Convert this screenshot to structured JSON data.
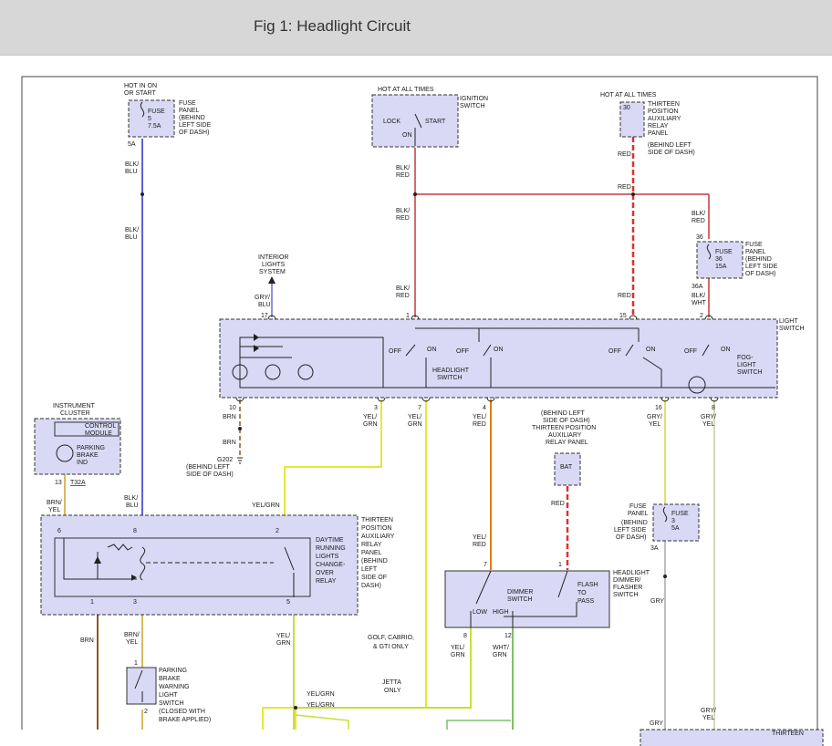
{
  "figure": {
    "title": "Fig 1: Headlight Circuit"
  },
  "colors": {
    "blue": "#2b2bcc",
    "red": "#c23b3b",
    "bright_red": "#e03030",
    "yellow": "#e6e63a",
    "yellow_green": "#c9df35",
    "brown": "#8b5a1e",
    "orange": "#e07d10",
    "green": "#7cbf6a",
    "gray": "#b9b9b9",
    "panel": "#d9d9f5"
  },
  "labels": {
    "hot_in_on": "HOT IN ON",
    "or_start": "OR START",
    "fuse5_a": "FUSE",
    "fuse5_b": "5",
    "fuse5_c": "7.5A",
    "fp1": "FUSE",
    "fp2": "PANEL",
    "fp3": "(BEHIND",
    "fp4": "LEFT SIDE",
    "fp5": "OF DASH)",
    "pin_5a": "5A",
    "blk1": "BLK/",
    "blu1": "BLU",
    "blk2": "BLK/",
    "blu2": "BLU",
    "hot_all_1": "HOT AT ALL TIMES",
    "lock": "LOCK",
    "start": "START",
    "on": "ON",
    "ign1": "IGNITION",
    "ign2": "SWITCH",
    "blkred_1a": "BLK/",
    "blkred_1b": "RED",
    "blkred_2a": "BLK/",
    "blkred_2b": "RED",
    "blkred_3a": "BLK/",
    "blkred_3b": "RED",
    "hot_all_2": "HOT AT ALL TIMES",
    "pin_30": "30",
    "tp1": "THIRTEEN",
    "tp2": "POSITION",
    "tp3": "AUXILIARY",
    "tp4": "RELAY",
    "tp5": "PANEL",
    "tp6": "(BEHIND LEFT",
    "tp7": "SIDE OF DASH)",
    "red_1": "RED",
    "red_2": "RED",
    "red_3": "RED",
    "blkred_4a": "BLK/",
    "blkred_4b": "RED",
    "pin_36": "36",
    "fuse36_a": "FUSE",
    "fuse36_b": "36",
    "fuse36_c": "15A",
    "fp36_1": "FUSE",
    "fp36_2": "PANEL",
    "fp36_3": "(BEHIND",
    "fp36_4": "LEFT SIDE",
    "fp36_5": "OF DASH)",
    "pin_36a": "36A",
    "blkwht_a": "BLK/",
    "blkwht_b": "WHT",
    "int1": "INTERIOR",
    "int2": "LIGHTS",
    "int3": "SYSTEM",
    "grybl_a": "GRY/",
    "grybl_b": "BLU",
    "pin_17": "17",
    "pin_1": "1",
    "pin_15": "15",
    "pin_2": "2",
    "ls1": "LIGHT",
    "ls2": "SWITCH",
    "off1": "OFF",
    "on1": "ON",
    "off2": "OFF",
    "on2": "ON",
    "off3": "OFF",
    "on3": "ON",
    "off4": "OFF",
    "on4": "ON",
    "hl1": "HEADLIGHT",
    "hl2": "SWITCH",
    "fog1": "FOG-",
    "fog2": "LIGHT",
    "fog3": "SWITCH",
    "pin_10": "10",
    "pin_3": "3",
    "pin_7": "7",
    "pin_4": "4",
    "pin_16": "16",
    "pin_8": "8",
    "brn_1": "BRN",
    "brn_2": "BRN",
    "yelgrn_1a": "YEL/",
    "yelgrn_1b": "GRN",
    "yelgrn_2a": "YEL/",
    "yelgrn_2b": "GRN",
    "yelred_1a": "YEL/",
    "yelred_1b": "RED",
    "gryyel_1a": "GRY/",
    "gryyel_1b": "YEL",
    "gryyel_2a": "GRY/",
    "gryyel_2b": "YEL",
    "g202": "G202",
    "g202_b": "(BEHIND LEFT",
    "g202_c": "SIDE OF DASH)",
    "ic1": "INSTRUMENT",
    "ic2": "CLUSTER",
    "cm1": "CONTROL",
    "cm2": "MODULE",
    "pb1": "PARKING",
    "pb2": "BRAKE",
    "pb3": "IND",
    "pin_13": "13",
    "t32a": "T32A",
    "brnyel_1a": "BRN/",
    "brnyel_1b": "YEL",
    "blkblu_3a": "BLK/",
    "blkblu_3b": "BLU",
    "yelgrn_3": "YEL/GRN",
    "rp1": "(BEHIND LEFT",
    "rp2": "SIDE OF DASH)",
    "rp3": "THIRTEEN POSITION",
    "rp4": "AUXILIARY",
    "rp5": "RELAY PANEL",
    "bat": "BAT",
    "red_4": "RED",
    "pin_6": "6",
    "pin_8b": "8",
    "pin_2b": "2",
    "pin_1b": "1",
    "pin_3b": "3",
    "pin_5b": "5",
    "drl1": "DAYTIME",
    "drl2": "RUNNING",
    "drl3": "LIGHTS",
    "drl4": "CHANGE-",
    "drl5": "OVER",
    "drl6": "RELAY",
    "drp1": "THIRTEEN",
    "drp2": "POSITION",
    "drp3": "AUXILIARY",
    "drp4": "RELAY",
    "drp5": "PANEL",
    "drp6": "(BEHIND",
    "drp7": "LEFT",
    "drp8": "SIDE OF",
    "drp9": "DASH)",
    "fuse3_a": "FUSE",
    "fuse3_b": "3",
    "fuse3_c": "5A",
    "fp3_1": "FUSE",
    "fp3_2": "PANEL",
    "fp3_3": "(BEHIND",
    "fp3_4": "LEFT SIDE",
    "fp3_5": "OF DASH)",
    "pin_3a": "3A",
    "gry_1": "GRY",
    "yelred_2a": "YEL/",
    "yelred_2b": "RED",
    "pin_7b": "7",
    "pin_1c": "1",
    "dim1": "DIMMER",
    "dim2": "SWITCH",
    "flash1": "FLASH",
    "flash2": "TO",
    "flash3": "PASS",
    "low": "LOW",
    "high": "HIGH",
    "hd1": "HEADLIGHT",
    "hd2": "DIMMER/",
    "hd3": "FLASHER",
    "hd4": "SWITCH",
    "pin_8c": "8",
    "pin_12": "12",
    "yelgrn_4a": "YEL/",
    "yelgrn_4b": "GRN",
    "whtgrn_a": "WHT/",
    "whtgrn_b": "GRN",
    "brn_3": "BRN",
    "brnyel_2a": "BRN/",
    "brnyel_2b": "YEL",
    "pin_1d": "1",
    "pin_2d": "2",
    "pbw1": "PARKING",
    "pbw2": "BRAKE",
    "pbw3": "WARNING",
    "pbw4": "LIGHT",
    "pbw5": "SWITCH",
    "pbw6": "(CLOSED WITH",
    "pbw7": "BRAKE APPLIED)",
    "yelgrn_5a": "YEL/",
    "yelgrn_5b": "GRN",
    "golf1": "GOLF, CABRIO,",
    "golf2": "& GTI ONLY",
    "jetta1": "JETTA",
    "jetta2": "ONLY",
    "yelgrn_6": "YEL/GRN",
    "yelgrn_7": "YEL/GRN",
    "gry_2": "GRY",
    "gryyel_3a": "GRY/",
    "gryyel_3b": "YEL",
    "thirteen_cut": "THIRTEEN"
  }
}
